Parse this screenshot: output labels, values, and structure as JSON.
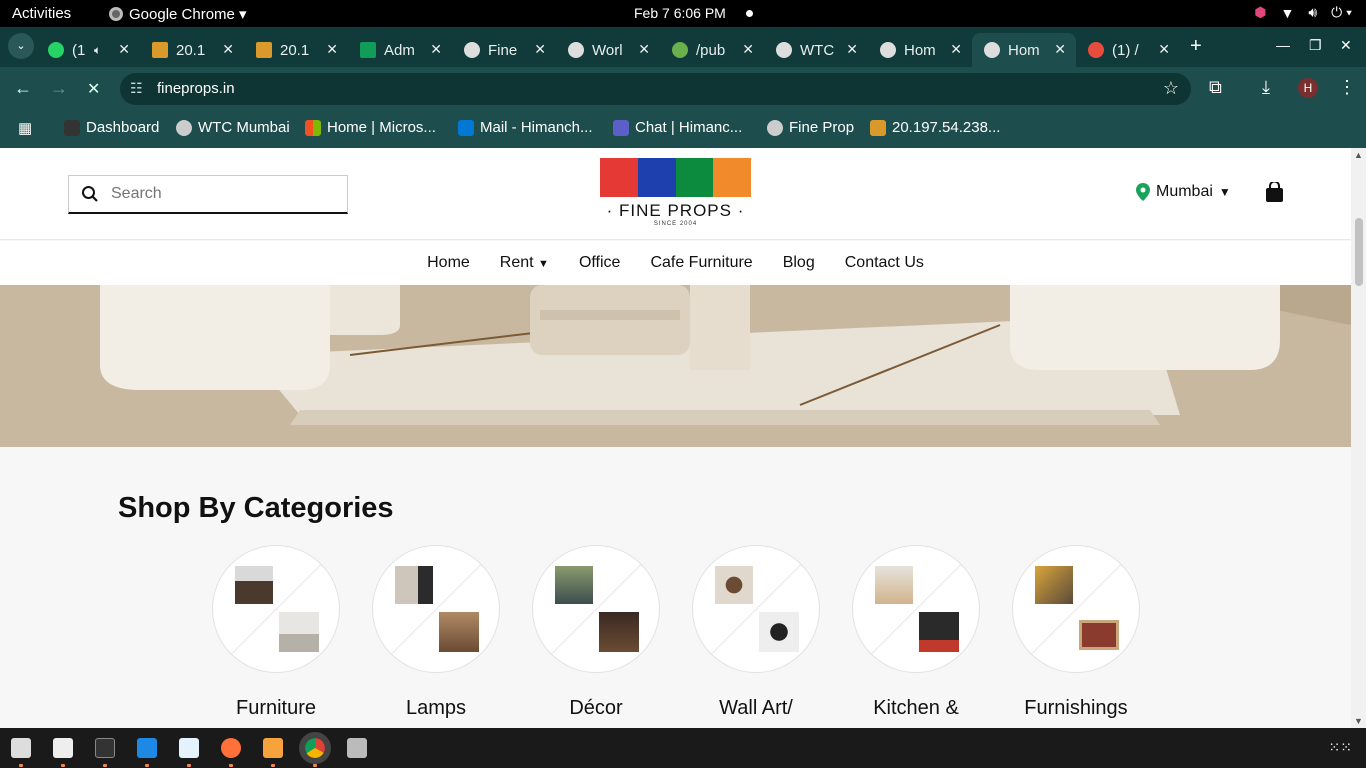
{
  "topbar": {
    "activities": "Activities",
    "app": "Google Chrome ▾",
    "clock": "Feb 7   6:06 PM"
  },
  "tabs": [
    {
      "title": "(1",
      "color": "#25d366"
    },
    {
      "title": "20.1",
      "color": "#d99a2b"
    },
    {
      "title": "20.1",
      "color": "#d99a2b"
    },
    {
      "title": "Adm",
      "color": "#0f9d58"
    },
    {
      "title": "Fine",
      "color": "#dddddd"
    },
    {
      "title": "Worl",
      "color": "#dddddd"
    },
    {
      "title": "/pub",
      "color": "#6ab04c"
    },
    {
      "title": "WTC",
      "color": "#dddddd"
    },
    {
      "title": "Hom",
      "color": "#dddddd"
    },
    {
      "title": "Hom",
      "color": "#dddddd"
    },
    {
      "title": "(1) /",
      "color": "#e84c3d"
    }
  ],
  "omnibox": {
    "url": "fineprops.in"
  },
  "profile": {
    "initial": "H"
  },
  "bookmarks": [
    {
      "label": "Dashboard",
      "color": "#333333"
    },
    {
      "label": "WTC Mumbai",
      "color": "#cccccc"
    },
    {
      "label": "Home | Micros...",
      "color": "#f25022"
    },
    {
      "label": "Mail - Himanch...",
      "color": "#0078d4"
    },
    {
      "label": "Chat | Himanc...",
      "color": "#5b5fc7"
    },
    {
      "label": "Fine Prop",
      "color": "#cccccc"
    },
    {
      "label": "20.197.54.238...",
      "color": "#d99a2b"
    }
  ],
  "site": {
    "search_placeholder": "Search",
    "brand": "· FINE PROPS ·",
    "since": "SINCE 2004",
    "city": "Mumbai",
    "nav": [
      "Home",
      "Rent",
      "Office",
      "Cafe Furniture",
      "Blog",
      "Contact Us"
    ],
    "categories_title": "Shop By Categories",
    "categories": [
      "Furniture",
      "Lamps",
      "Décor",
      "Wall Art/",
      "Kitchen &",
      "Furnishings"
    ]
  },
  "colors": {
    "accent_red": "#e53935",
    "accent_blue": "#1e3fae",
    "accent_green": "#0c8a3d",
    "accent_orange": "#f08a2a",
    "pin_green": "#1aa35a"
  }
}
